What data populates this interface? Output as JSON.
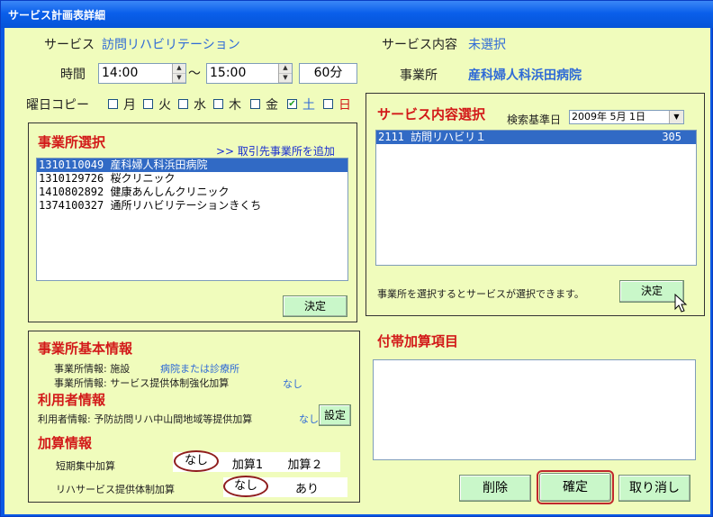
{
  "window": {
    "title": "サービス計画表詳細"
  },
  "top": {
    "service_label": "サービス",
    "service_value": "訪問リハビリテーション",
    "service_content_label": "サービス内容",
    "service_content_value": "未選択",
    "office_label": "事業所",
    "office_value": "産科婦人科浜田病院",
    "time_label": "時間",
    "start_time": "14:00",
    "tilde": "～",
    "end_time": "15:00",
    "duration": "60分",
    "weekday_copy_label": "曜日コピー",
    "weekdays": [
      {
        "label": "月",
        "checked": false
      },
      {
        "label": "火",
        "checked": false
      },
      {
        "label": "水",
        "checked": false
      },
      {
        "label": "木",
        "checked": false
      },
      {
        "label": "金",
        "checked": true
      },
      {
        "label": "土",
        "checked": false
      },
      {
        "label": "日",
        "checked": false
      }
    ]
  },
  "office_select": {
    "heading": "事業所選択",
    "add_link": ">> 取引先事業所を追加",
    "items": [
      "1310110049 産科婦人科浜田病院",
      "1310129726 桜クリニック",
      "1410802892 健康あんしんクリニック",
      "1374100327 通所リハビリテーションきくち"
    ],
    "selected_index": 0,
    "decide_button": "決定"
  },
  "service_select": {
    "heading": "サービス内容選択",
    "search_date_label": "検索基準日",
    "search_date_value": "2009年 5月 1日",
    "items": [
      {
        "code": "2111 訪問リハビリ１",
        "units": "305"
      }
    ],
    "hint": "事業所を選択するとサービスが選択できます。",
    "decide_button": "決定"
  },
  "office_info": {
    "heading": "事業所基本情報",
    "facility_label": "事業所情報: 施設",
    "facility_value": "病院または診療所",
    "strengthen_label": "事業所情報: サービス提供体制強化加算",
    "strengthen_value": "なし",
    "user_heading": "利用者情報",
    "user_label": "利用者情報: 予防訪問リハ中山間地域等提供加算",
    "user_value": "なし",
    "user_button": "設定",
    "addition_heading": "加算情報",
    "short_term_label": "短期集中加算",
    "short_term_options": [
      "なし",
      "加算1",
      "加算２"
    ],
    "rehab_label": "リハサービス提供体制加算",
    "rehab_options": [
      "なし",
      "あり"
    ]
  },
  "incidental": {
    "heading": "付帯加算項目"
  },
  "footer": {
    "delete_button": "削除",
    "confirm_button": "確定",
    "cancel_button": "取り消し"
  }
}
